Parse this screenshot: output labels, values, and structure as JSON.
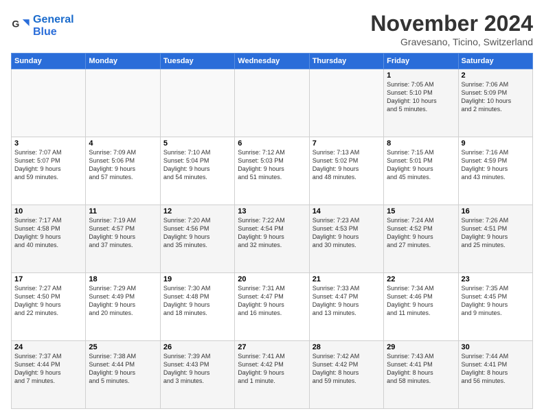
{
  "logo": {
    "line1": "General",
    "line2": "Blue"
  },
  "header": {
    "month": "November 2024",
    "location": "Gravesano, Ticino, Switzerland"
  },
  "weekdays": [
    "Sunday",
    "Monday",
    "Tuesday",
    "Wednesday",
    "Thursday",
    "Friday",
    "Saturday"
  ],
  "weeks": [
    [
      {
        "day": "",
        "info": ""
      },
      {
        "day": "",
        "info": ""
      },
      {
        "day": "",
        "info": ""
      },
      {
        "day": "",
        "info": ""
      },
      {
        "day": "",
        "info": ""
      },
      {
        "day": "1",
        "info": "Sunrise: 7:05 AM\nSunset: 5:10 PM\nDaylight: 10 hours\nand 5 minutes."
      },
      {
        "day": "2",
        "info": "Sunrise: 7:06 AM\nSunset: 5:09 PM\nDaylight: 10 hours\nand 2 minutes."
      }
    ],
    [
      {
        "day": "3",
        "info": "Sunrise: 7:07 AM\nSunset: 5:07 PM\nDaylight: 9 hours\nand 59 minutes."
      },
      {
        "day": "4",
        "info": "Sunrise: 7:09 AM\nSunset: 5:06 PM\nDaylight: 9 hours\nand 57 minutes."
      },
      {
        "day": "5",
        "info": "Sunrise: 7:10 AM\nSunset: 5:04 PM\nDaylight: 9 hours\nand 54 minutes."
      },
      {
        "day": "6",
        "info": "Sunrise: 7:12 AM\nSunset: 5:03 PM\nDaylight: 9 hours\nand 51 minutes."
      },
      {
        "day": "7",
        "info": "Sunrise: 7:13 AM\nSunset: 5:02 PM\nDaylight: 9 hours\nand 48 minutes."
      },
      {
        "day": "8",
        "info": "Sunrise: 7:15 AM\nSunset: 5:01 PM\nDaylight: 9 hours\nand 45 minutes."
      },
      {
        "day": "9",
        "info": "Sunrise: 7:16 AM\nSunset: 4:59 PM\nDaylight: 9 hours\nand 43 minutes."
      }
    ],
    [
      {
        "day": "10",
        "info": "Sunrise: 7:17 AM\nSunset: 4:58 PM\nDaylight: 9 hours\nand 40 minutes."
      },
      {
        "day": "11",
        "info": "Sunrise: 7:19 AM\nSunset: 4:57 PM\nDaylight: 9 hours\nand 37 minutes."
      },
      {
        "day": "12",
        "info": "Sunrise: 7:20 AM\nSunset: 4:56 PM\nDaylight: 9 hours\nand 35 minutes."
      },
      {
        "day": "13",
        "info": "Sunrise: 7:22 AM\nSunset: 4:54 PM\nDaylight: 9 hours\nand 32 minutes."
      },
      {
        "day": "14",
        "info": "Sunrise: 7:23 AM\nSunset: 4:53 PM\nDaylight: 9 hours\nand 30 minutes."
      },
      {
        "day": "15",
        "info": "Sunrise: 7:24 AM\nSunset: 4:52 PM\nDaylight: 9 hours\nand 27 minutes."
      },
      {
        "day": "16",
        "info": "Sunrise: 7:26 AM\nSunset: 4:51 PM\nDaylight: 9 hours\nand 25 minutes."
      }
    ],
    [
      {
        "day": "17",
        "info": "Sunrise: 7:27 AM\nSunset: 4:50 PM\nDaylight: 9 hours\nand 22 minutes."
      },
      {
        "day": "18",
        "info": "Sunrise: 7:29 AM\nSunset: 4:49 PM\nDaylight: 9 hours\nand 20 minutes."
      },
      {
        "day": "19",
        "info": "Sunrise: 7:30 AM\nSunset: 4:48 PM\nDaylight: 9 hours\nand 18 minutes."
      },
      {
        "day": "20",
        "info": "Sunrise: 7:31 AM\nSunset: 4:47 PM\nDaylight: 9 hours\nand 16 minutes."
      },
      {
        "day": "21",
        "info": "Sunrise: 7:33 AM\nSunset: 4:47 PM\nDaylight: 9 hours\nand 13 minutes."
      },
      {
        "day": "22",
        "info": "Sunrise: 7:34 AM\nSunset: 4:46 PM\nDaylight: 9 hours\nand 11 minutes."
      },
      {
        "day": "23",
        "info": "Sunrise: 7:35 AM\nSunset: 4:45 PM\nDaylight: 9 hours\nand 9 minutes."
      }
    ],
    [
      {
        "day": "24",
        "info": "Sunrise: 7:37 AM\nSunset: 4:44 PM\nDaylight: 9 hours\nand 7 minutes."
      },
      {
        "day": "25",
        "info": "Sunrise: 7:38 AM\nSunset: 4:44 PM\nDaylight: 9 hours\nand 5 minutes."
      },
      {
        "day": "26",
        "info": "Sunrise: 7:39 AM\nSunset: 4:43 PM\nDaylight: 9 hours\nand 3 minutes."
      },
      {
        "day": "27",
        "info": "Sunrise: 7:41 AM\nSunset: 4:42 PM\nDaylight: 9 hours\nand 1 minute."
      },
      {
        "day": "28",
        "info": "Sunrise: 7:42 AM\nSunset: 4:42 PM\nDaylight: 8 hours\nand 59 minutes."
      },
      {
        "day": "29",
        "info": "Sunrise: 7:43 AM\nSunset: 4:41 PM\nDaylight: 8 hours\nand 58 minutes."
      },
      {
        "day": "30",
        "info": "Sunrise: 7:44 AM\nSunset: 4:41 PM\nDaylight: 8 hours\nand 56 minutes."
      }
    ]
  ]
}
